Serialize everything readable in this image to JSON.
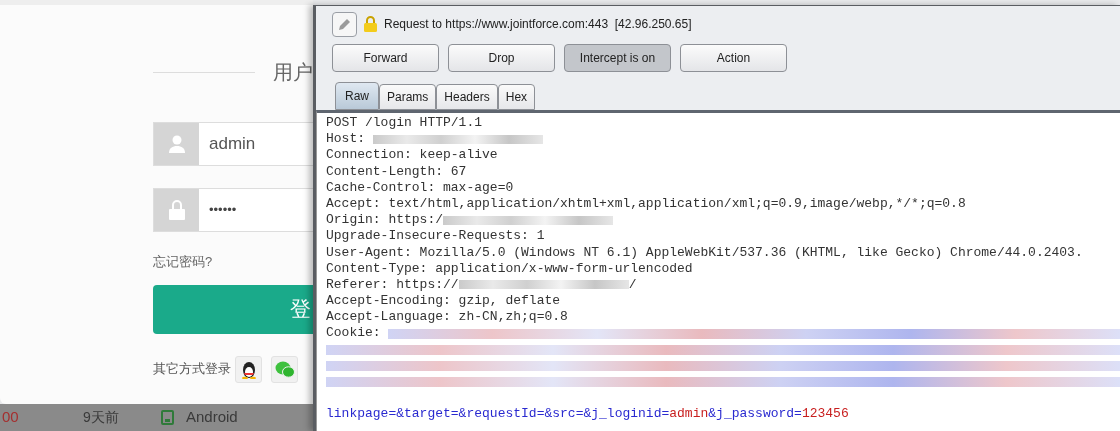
{
  "login": {
    "title": "用户",
    "username": "admin",
    "password": "••••••",
    "forgot": "忘记密码?",
    "submit": "登",
    "other_login": "其它方式登录"
  },
  "background_row": {
    "price": "00",
    "time": "9天前",
    "platform": "Android"
  },
  "intercept": {
    "title": "Request to https://www.jointforce.com:443  [42.96.250.65]",
    "buttons": [
      {
        "label": "Forward",
        "pressed": false
      },
      {
        "label": "Drop",
        "pressed": false
      },
      {
        "label": "Intercept is on",
        "pressed": true
      },
      {
        "label": "Action",
        "pressed": false
      }
    ],
    "tabs": [
      {
        "label": "Raw",
        "selected": true
      },
      {
        "label": "Params",
        "selected": false
      },
      {
        "label": "Headers",
        "selected": false
      },
      {
        "label": "Hex",
        "selected": false
      }
    ],
    "lines": [
      {
        "text": "POST /login HTTP/1.1"
      },
      {
        "text": "Host: ",
        "redacted": true,
        "tinted": false
      },
      {
        "text": "Connection: keep-alive"
      },
      {
        "text": "Content-Length: 67"
      },
      {
        "text": "Cache-Control: max-age=0"
      },
      {
        "text": "Accept: text/html,application/xhtml+xml,application/xml;q=0.9,image/webp,*/*;q=0.8"
      },
      {
        "text": "Origin: https:/",
        "redacted": true,
        "tinted": false
      },
      {
        "text": "Upgrade-Insecure-Requests: 1"
      },
      {
        "text": "User-Agent: Mozilla/5.0 (Windows NT 6.1) AppleWebKit/537.36 (KHTML, like Gecko) Chrome/44.0.2403."
      },
      {
        "text": "Content-Type: application/x-www-form-urlencoded"
      },
      {
        "text": "Referer: https://",
        "redacted": true,
        "tinted": false,
        "after": "/"
      },
      {
        "text": "Accept-Encoding: gzip, deflate"
      },
      {
        "text": "Accept-Language: zh-CN,zh;q=0.8"
      },
      {
        "text": "Cookie: ",
        "redacted": true,
        "tinted": true
      },
      {
        "redacted": true,
        "tinted": true
      },
      {
        "redacted": true,
        "tinted": true
      },
      {
        "redacted": true,
        "tinted": true
      }
    ],
    "body": [
      {
        "text": "linkpage=&target=&requestId=&src=&j_loginid=",
        "kind": "key"
      },
      {
        "text": "admin",
        "kind": "value"
      },
      {
        "text": "&j_password=",
        "kind": "key"
      },
      {
        "text": "123456",
        "kind": "value"
      }
    ]
  }
}
